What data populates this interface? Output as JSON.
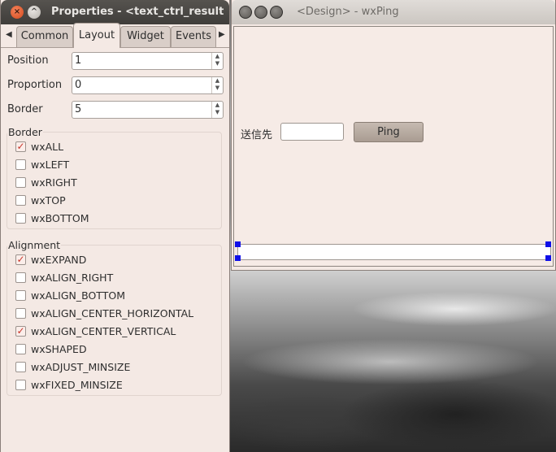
{
  "props_window": {
    "title": "Properties - <text_ctrl_result",
    "close_glyph": "×",
    "min_glyph": "^",
    "tab_left_arrow": "◀",
    "tab_right_arrow": "▶",
    "tabs": [
      {
        "label": "Common"
      },
      {
        "label": "Layout"
      },
      {
        "label": "Widget"
      },
      {
        "label": "Events"
      }
    ],
    "active_tab": "Layout",
    "position_label": "Position",
    "position_value": "1",
    "proportion_label": "Proportion",
    "proportion_value": "0",
    "border_label": "Border",
    "border_value": "5",
    "spin_up": "▲",
    "spin_down": "▼",
    "border_group": {
      "title": "Border",
      "items": [
        {
          "label": "wxALL",
          "checked": true
        },
        {
          "label": "wxLEFT",
          "checked": false
        },
        {
          "label": "wxRIGHT",
          "checked": false
        },
        {
          "label": "wxTOP",
          "checked": false
        },
        {
          "label": "wxBOTTOM",
          "checked": false
        }
      ]
    },
    "alignment_group": {
      "title": "Alignment",
      "items": [
        {
          "label": "wxEXPAND",
          "checked": true
        },
        {
          "label": "wxALIGN_RIGHT",
          "checked": false
        },
        {
          "label": "wxALIGN_BOTTOM",
          "checked": false
        },
        {
          "label": "wxALIGN_CENTER_HORIZONTAL",
          "checked": false
        },
        {
          "label": "wxALIGN_CENTER_VERTICAL",
          "checked": true
        },
        {
          "label": "wxSHAPED",
          "checked": false
        },
        {
          "label": "wxADJUST_MINSIZE",
          "checked": false
        },
        {
          "label": "wxFIXED_MINSIZE",
          "checked": false
        }
      ]
    },
    "check_glyph": "✓"
  },
  "design_window": {
    "title": "<Design> - wxPing",
    "label": "送信先",
    "input_value": "",
    "ping_button": "Ping"
  },
  "colors": {
    "selection_handle": "#1010e8",
    "checkmark": "#c8352a"
  }
}
